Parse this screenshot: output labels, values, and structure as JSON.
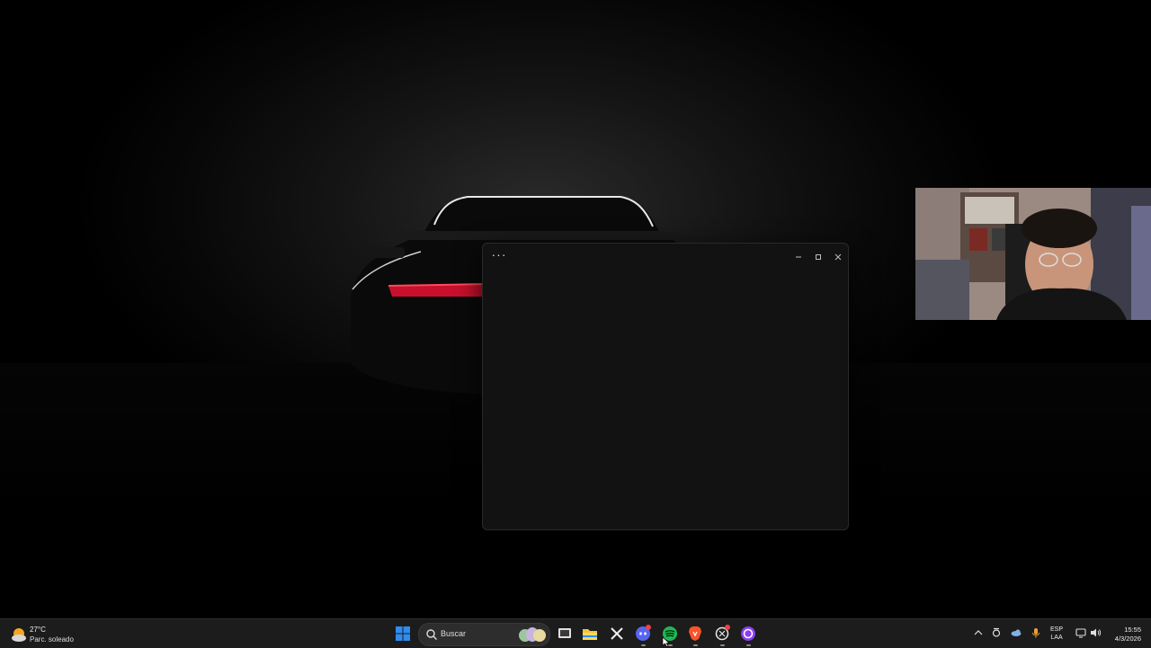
{
  "weather": {
    "temperature": "27°C",
    "description": "Parc. soleado"
  },
  "search": {
    "placeholder": "Buscar"
  },
  "window": {
    "more_label": "···"
  },
  "tray": {
    "language": "ESP",
    "layout": "LAA",
    "time": "15:55",
    "date": "4/3/2026"
  },
  "taskbar_icons": [
    "windows-start-icon",
    "search-icon",
    "widget-decoration-icon",
    "task-view-icon",
    "file-explorer-icon",
    "capcut-icon",
    "discord-icon",
    "spotify-icon",
    "brave-icon",
    "chatgpt-icon",
    "app-purple-icon"
  ],
  "colors": {
    "taskbar": "#1c1c1c",
    "window": "#121212",
    "start_blue": "#2f8cf0",
    "spotify_green": "#1db954",
    "brave_orange": "#fb542b",
    "discord_blurple": "#5865f2"
  }
}
